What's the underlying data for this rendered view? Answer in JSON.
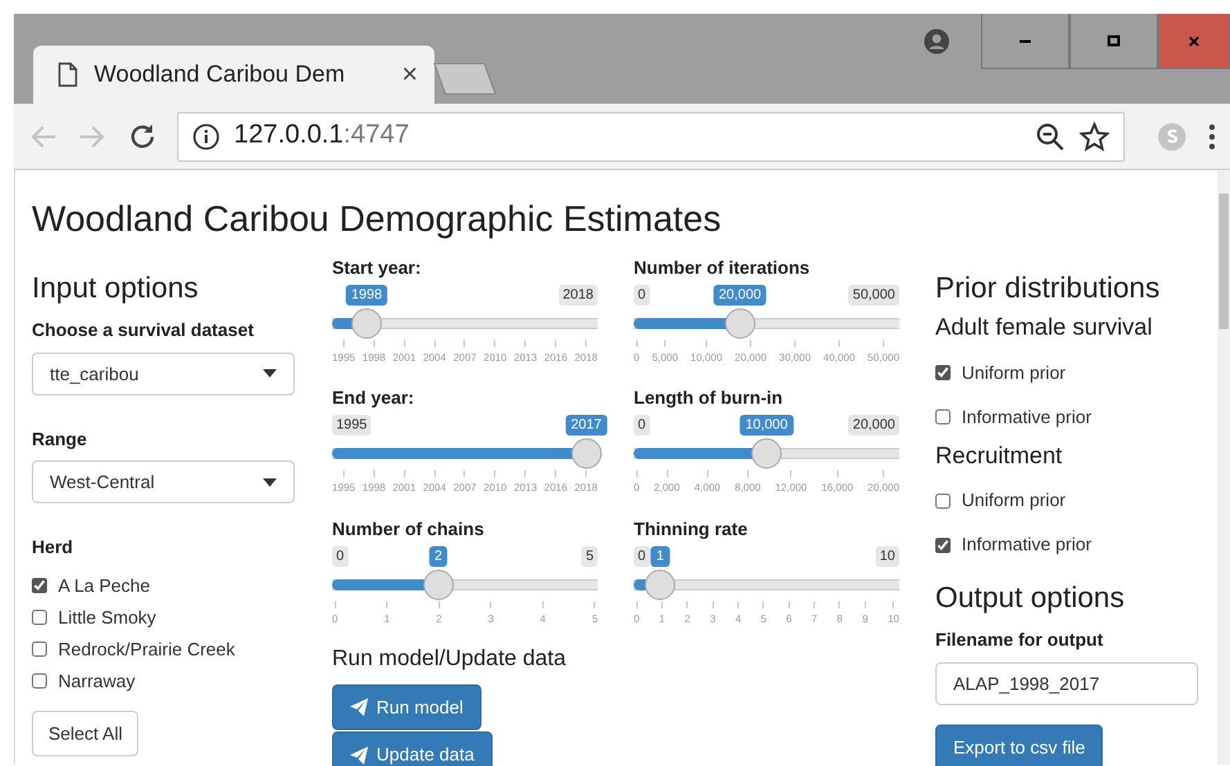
{
  "browser": {
    "tab": {
      "title": "Woodland Caribou Dem",
      "close": "×"
    },
    "nav": {
      "back_enabled": false,
      "forward_enabled": false
    },
    "address": {
      "host": "127.0.0.1",
      "port": ":4747"
    }
  },
  "page": {
    "title": "Woodland Caribou Demographic Estimates",
    "input_options": {
      "heading": "Input options",
      "dataset": {
        "label": "Choose a survival dataset",
        "value": "tte_caribou"
      },
      "range": {
        "label": "Range",
        "value": "West-Central"
      },
      "herd": {
        "label": "Herd",
        "options": [
          {
            "label": "A La Peche",
            "checked": true
          },
          {
            "label": "Little Smoky",
            "checked": false
          },
          {
            "label": "Redrock/Prairie Creek",
            "checked": false
          },
          {
            "label": "Narraway",
            "checked": false
          }
        ]
      },
      "select_all": "Select All"
    },
    "slider_columns": [
      [
        {
          "label": "Start year:",
          "value": "1998",
          "max": "2018",
          "level": 0.13,
          "ticks": [
            "1995",
            "1998",
            "2001",
            "2004",
            "2007",
            "2010",
            "2013",
            "2016",
            "2018"
          ]
        },
        {
          "label": "End year:",
          "min": "1995",
          "value": "2017",
          "level": 0.957,
          "ticks": [
            "1995",
            "1998",
            "2001",
            "2004",
            "2007",
            "2010",
            "2013",
            "2016",
            "2018"
          ]
        },
        {
          "label": "Number of chains",
          "min": "0",
          "value": "2",
          "max": "5",
          "level": 0.4,
          "ticks": [
            "0",
            "1",
            "2",
            "3",
            "4",
            "5"
          ]
        }
      ],
      [
        {
          "label": "Number of iterations",
          "min": "0",
          "value": "20,000",
          "max": "50,000",
          "level": 0.4,
          "ticks": [
            "0",
            "5,000",
            "10,000",
            "20,000",
            "30,000",
            "40,000",
            "50,000"
          ]
        },
        {
          "label": "Length of burn-in",
          "min": "0",
          "value": "10,000",
          "max": "20,000",
          "level": 0.5,
          "ticks": [
            "0",
            "2,000",
            "4,000",
            "8,000",
            "12,000",
            "16,000",
            "20,000"
          ]
        },
        {
          "label": "Thinning rate",
          "min": "0",
          "value": "1",
          "max": "10",
          "level": 0.1,
          "ticks": [
            "0",
            "1",
            "2",
            "3",
            "4",
            "5",
            "6",
            "7",
            "8",
            "9",
            "10"
          ]
        }
      ]
    ],
    "run": {
      "heading": "Run model/Update data",
      "buttons": [
        "Run model",
        "Update data"
      ]
    },
    "priors": {
      "heading": "Prior distributions",
      "groups": [
        {
          "title": "Adult female survival",
          "options": [
            {
              "label": "Uniform prior",
              "checked": true
            },
            {
              "label": "Informative prior",
              "checked": false
            }
          ]
        },
        {
          "title": "Recruitment",
          "options": [
            {
              "label": "Uniform prior",
              "checked": false
            },
            {
              "label": "Informative prior",
              "checked": true
            }
          ]
        }
      ]
    },
    "output": {
      "heading": "Output options",
      "filename": {
        "label": "Filename for output",
        "value": "ALAP_1998_2017"
      },
      "export": "Export to csv file"
    }
  }
}
